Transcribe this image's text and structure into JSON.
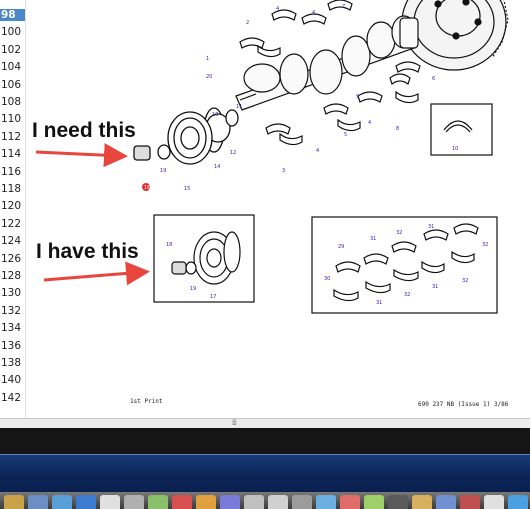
{
  "editor": {
    "line_numbers": [
      "98",
      "100",
      "102",
      "104",
      "106",
      "108",
      "110",
      "112",
      "114",
      "116",
      "118",
      "120",
      "122",
      "124",
      "126",
      "128",
      "130",
      "132",
      "134",
      "136",
      "138",
      "140",
      "142"
    ],
    "active_line": "98"
  },
  "annotations": {
    "need_label": "I need this",
    "have_label": "I have this",
    "arrow_color": "#e8453c"
  },
  "diagram": {
    "part_numbers_main": [
      "1",
      "2",
      "3",
      "4",
      "5",
      "6",
      "7",
      "8",
      "9",
      "10",
      "11",
      "12",
      "13",
      "14",
      "15",
      "16",
      "19",
      "20"
    ],
    "callouts": {
      "c1": "1",
      "c2": "2",
      "c3": "3",
      "c4a": "4",
      "c4b": "4",
      "c4c": "4",
      "c4d": "4",
      "c5": "5",
      "c6": "6",
      "c7": "7",
      "c8": "8",
      "c9": "9",
      "c10": "10",
      "c11": "11",
      "c12": "12",
      "c13": "13",
      "c14": "14",
      "c15": "15",
      "c16": "16",
      "c19": "19",
      "c20": "20",
      "d18": "18",
      "d19": "19",
      "d17": "17",
      "e29": "29",
      "e31a": "31",
      "e32a": "32",
      "e31b": "31",
      "e32b": "32",
      "e30": "30",
      "e31c": "31",
      "e32c": "32",
      "e31d": "31",
      "e32d": "32"
    }
  },
  "footer": {
    "left": "1st Print",
    "right": "690 237 NB (Issue 1) 3/86"
  },
  "colors": {
    "selection_blue": "#4a86c8",
    "taskbar_blue": "#0b2456",
    "callout_text": "#2a2ab8"
  }
}
